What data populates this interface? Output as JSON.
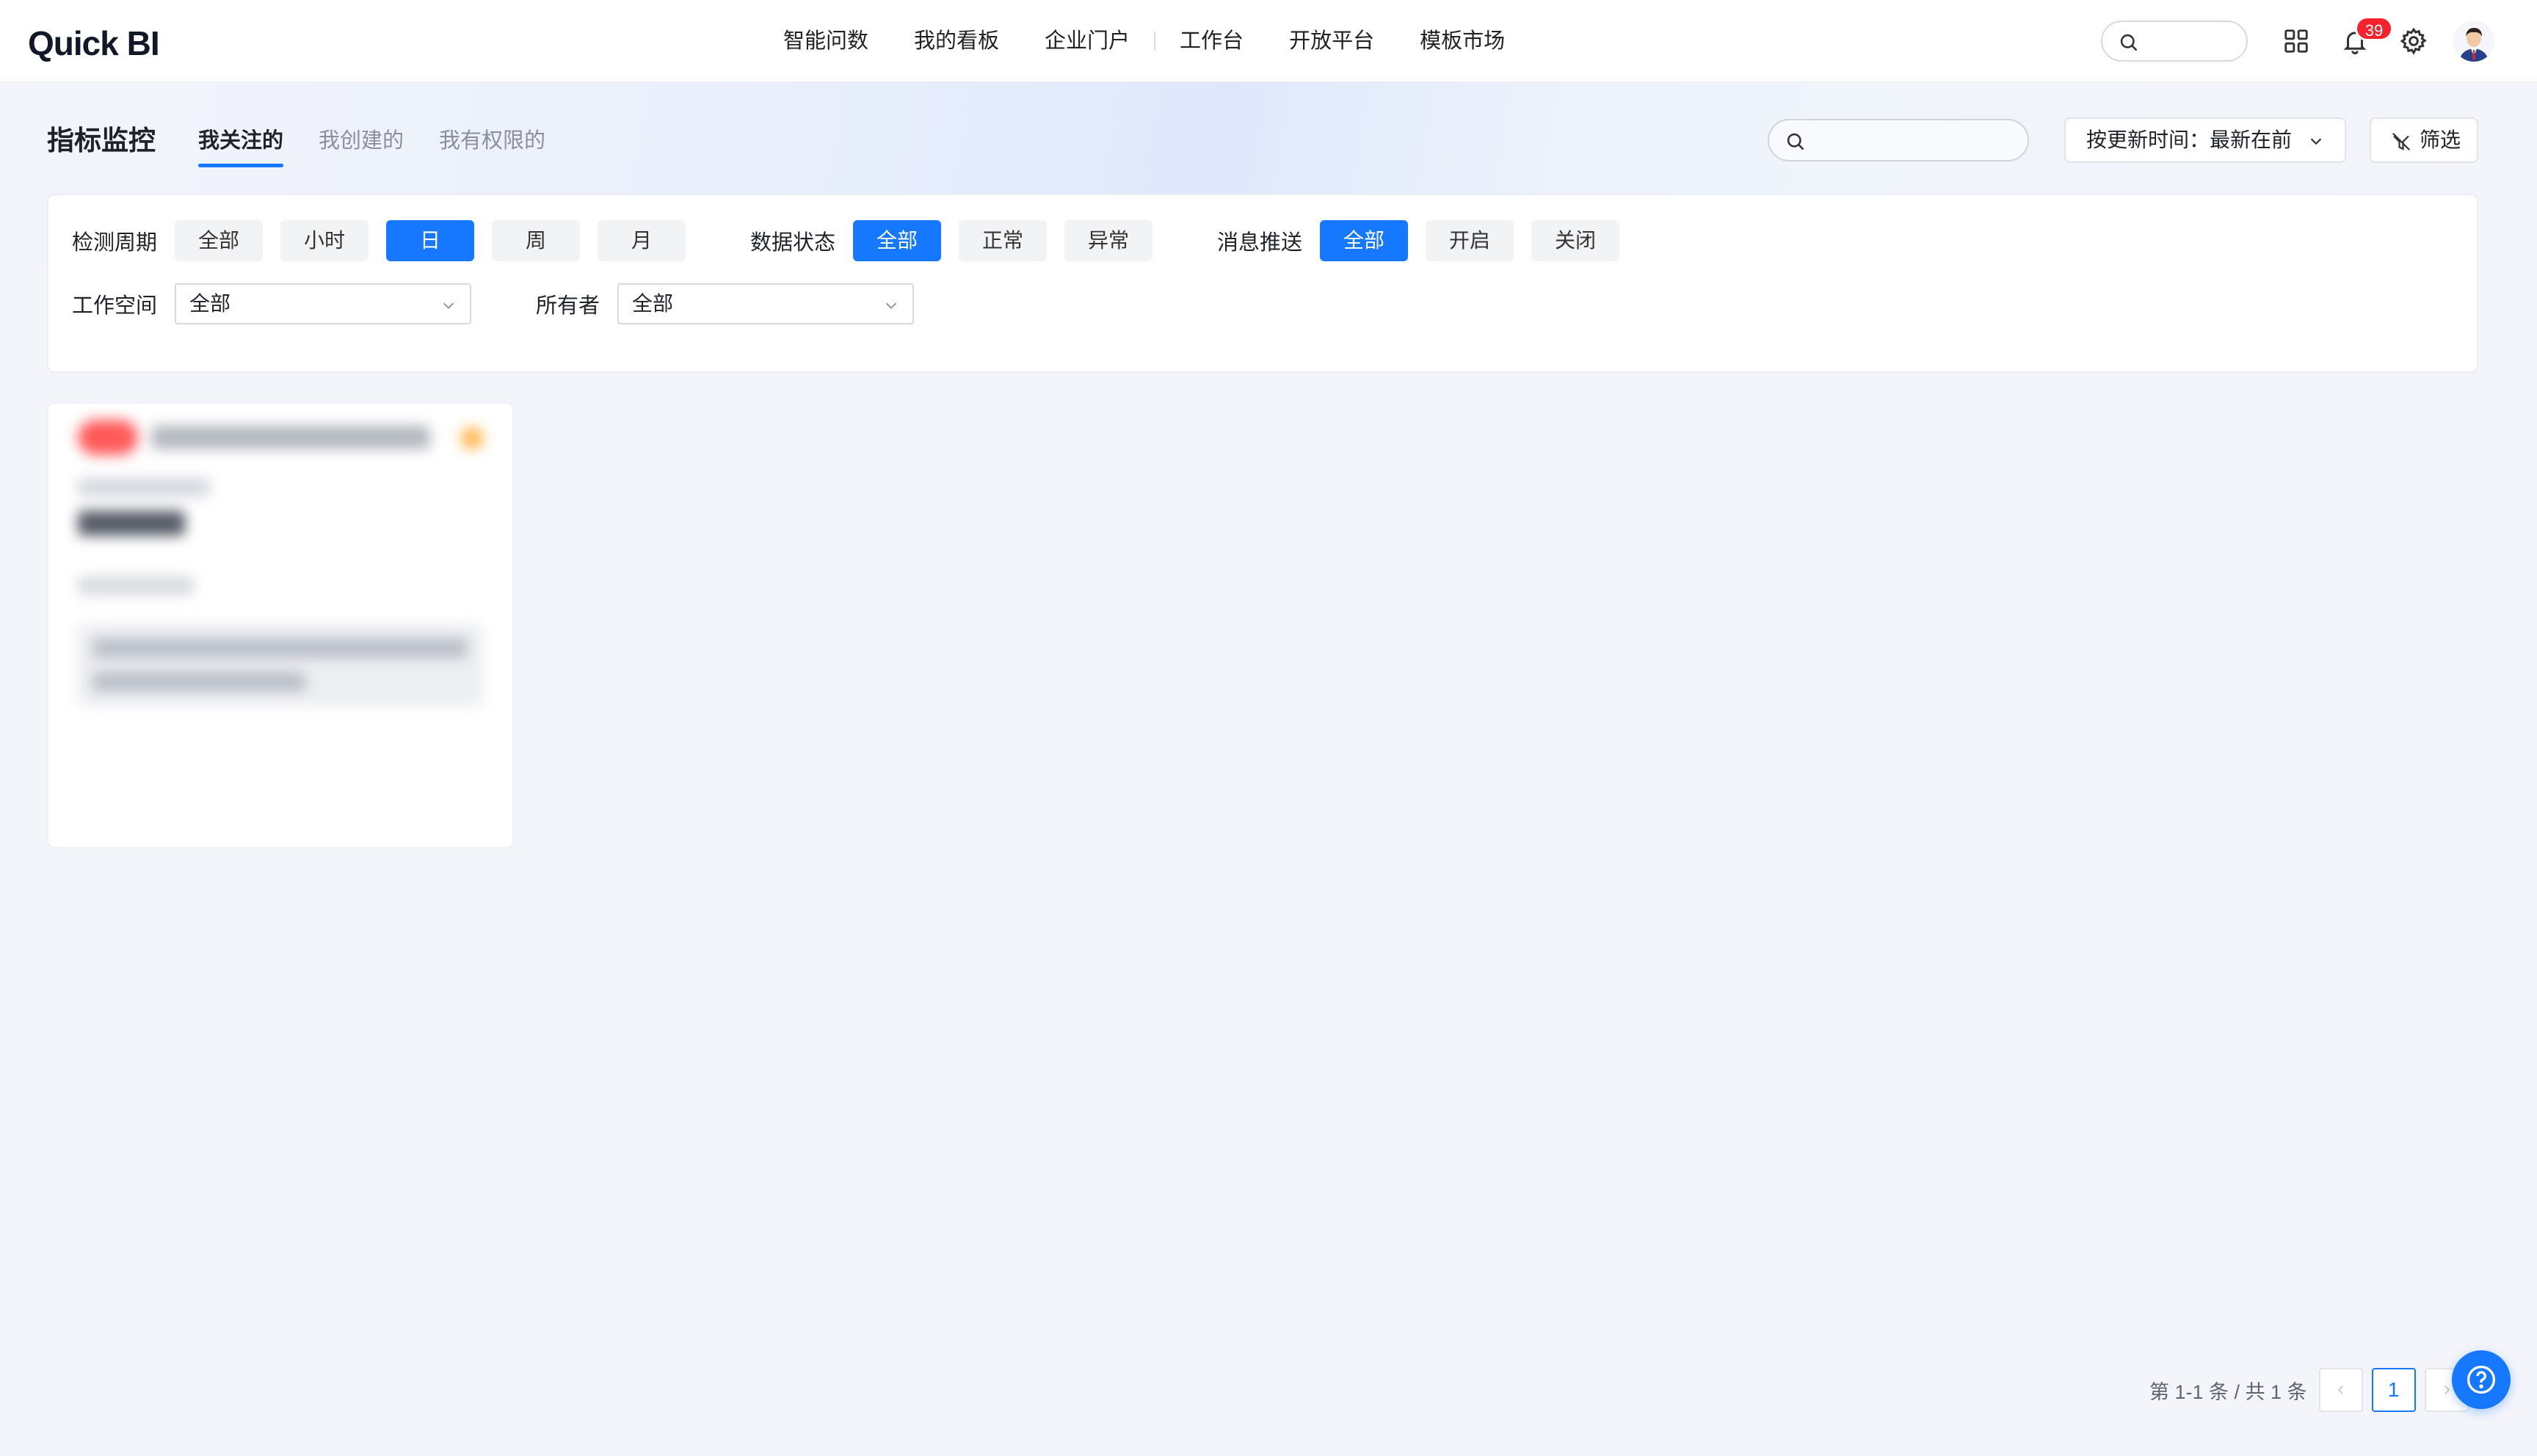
{
  "app": {
    "logo_prefix": "Qu",
    "logo_rest": "ick BI"
  },
  "nav": {
    "items": [
      "智能问数",
      "我的看板",
      "企业门户",
      "工作台",
      "开放平台",
      "模板市场"
    ]
  },
  "header": {
    "notification_count": "39"
  },
  "page": {
    "title": "指标监控",
    "tabs": [
      "我关注的",
      "我创建的",
      "我有权限的"
    ],
    "active_tab": "我关注的",
    "sort_label": "按更新时间：最新在前",
    "filter_label": "筛选"
  },
  "filters": {
    "period": {
      "label": "检测周期",
      "options": [
        "全部",
        "小时",
        "日",
        "周",
        "月"
      ],
      "selected": "日"
    },
    "data_status": {
      "label": "数据状态",
      "options": [
        "全部",
        "正常",
        "异常"
      ],
      "selected": "全部"
    },
    "push": {
      "label": "消息推送",
      "options": [
        "全部",
        "开启",
        "关闭"
      ],
      "selected": "全部"
    },
    "workspace": {
      "label": "工作空间",
      "value": "全部"
    },
    "owner": {
      "label": "所有者",
      "value": "全部"
    }
  },
  "pagination": {
    "summary": "第 1-1 条 / 共 1 条",
    "current_page": "1"
  },
  "colors": {
    "accent": "#1677ff",
    "badge": "#f5222d",
    "card_tag": "#ff5a5a",
    "card_star": "#ffb347"
  },
  "icons": [
    "search-icon",
    "apps-grid-icon",
    "bell-icon",
    "gear-icon",
    "avatar",
    "chevron-down-icon",
    "filter-icon",
    "help-icon"
  ]
}
